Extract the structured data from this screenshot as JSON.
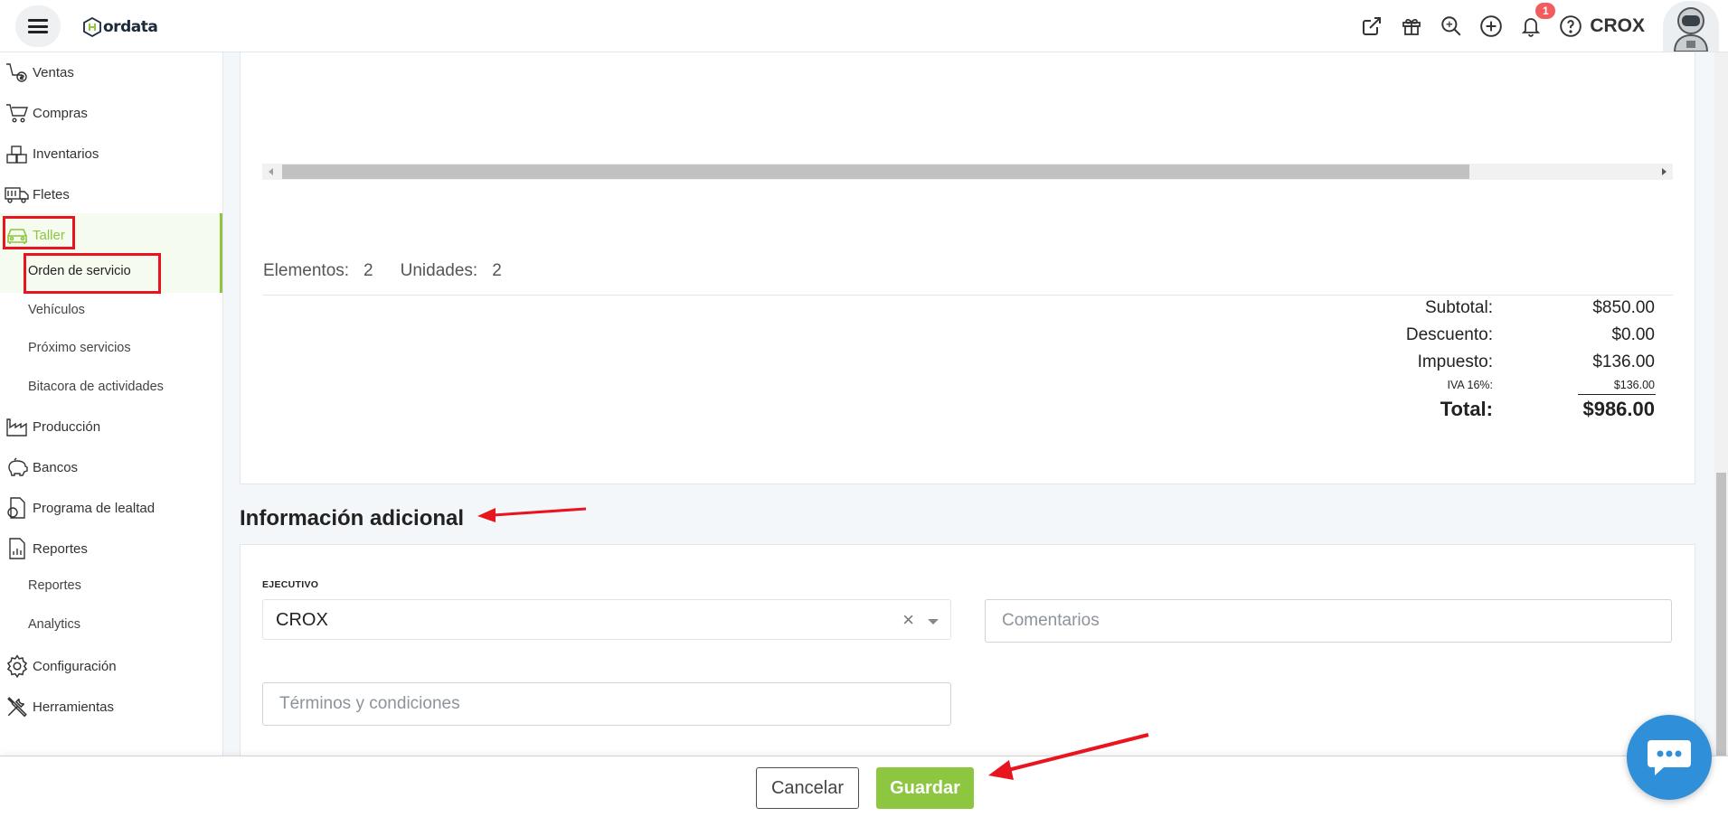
{
  "app": {
    "logo_text": "ordata"
  },
  "header": {
    "icons": [
      "external-link-icon",
      "gift-icon",
      "search-icon",
      "add-icon",
      "bell-icon",
      "help-icon"
    ],
    "notification_count": "1",
    "user_name": "CROX"
  },
  "sidebar": {
    "items": [
      {
        "label": "Ventas",
        "icon": "sales-icon"
      },
      {
        "label": "Compras",
        "icon": "cart-icon"
      },
      {
        "label": "Inventarios",
        "icon": "boxes-icon"
      },
      {
        "label": "Fletes",
        "icon": "truck-icon"
      },
      {
        "label": "Taller",
        "icon": "car-icon",
        "active": true
      },
      {
        "label": "Producción",
        "icon": "factory-icon"
      },
      {
        "label": "Bancos",
        "icon": "piggy-bank-icon"
      },
      {
        "label": "Programa de lealtad",
        "icon": "loyalty-icon"
      },
      {
        "label": "Reportes",
        "icon": "report-icon"
      },
      {
        "label": "Configuración",
        "icon": "gear-icon"
      },
      {
        "label": "Herramientas",
        "icon": "tools-icon"
      }
    ],
    "taller_sub": [
      "Orden de servicio",
      "Vehículos",
      "Próximo servicios",
      "Bitacora de actividades"
    ],
    "reportes_sub": [
      "Reportes",
      "Analytics"
    ]
  },
  "summary": {
    "elementos_label": "Elementos:",
    "elementos_value": "2",
    "unidades_label": "Unidades:",
    "unidades_value": "2",
    "subtotal_label": "Subtotal:",
    "subtotal_value": "$850.00",
    "descuento_label": "Descuento:",
    "descuento_value": "$0.00",
    "impuesto_label": "Impuesto:",
    "impuesto_value": "$136.00",
    "iva_label": "IVA 16%:",
    "iva_value": "$136.00",
    "total_label": "Total:",
    "total_value": "$986.00"
  },
  "additional": {
    "title": "Información adicional",
    "ejecutivo_label": "EJECUTIVO",
    "ejecutivo_value": "CROX",
    "comentarios_placeholder": "Comentarios",
    "terminos_placeholder": "Términos y condiciones"
  },
  "footer": {
    "cancel_label": "Cancelar",
    "save_label": "Guardar"
  },
  "colors": {
    "accent": "#8dc63f",
    "annotation_red": "#e8141e",
    "chat_blue": "#2f8fd8",
    "badge_red": "#f25c5c"
  }
}
